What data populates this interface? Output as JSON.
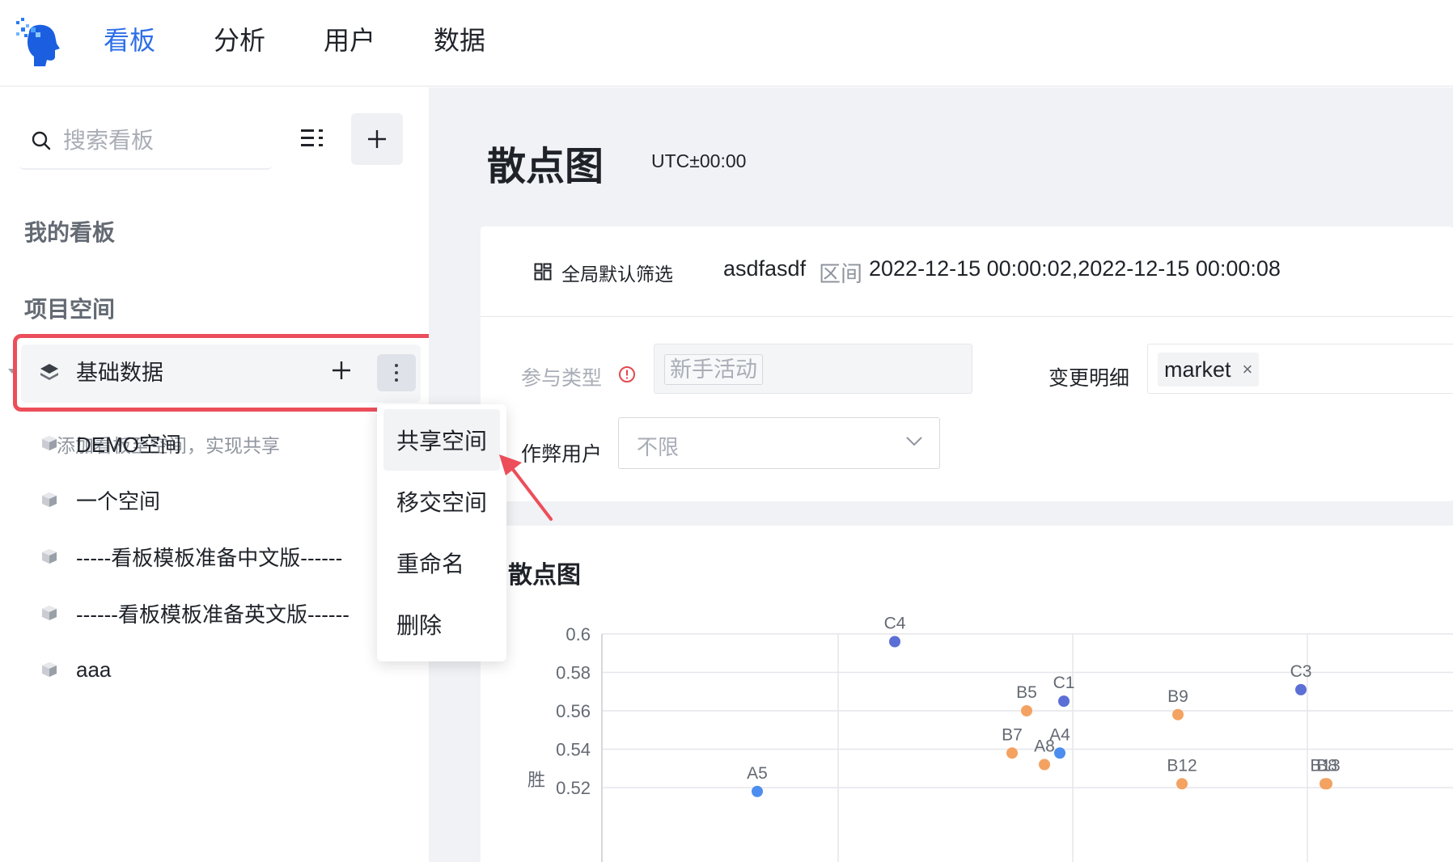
{
  "nav": {
    "items": [
      {
        "label": "看板",
        "active": true
      },
      {
        "label": "分析",
        "active": false
      },
      {
        "label": "用户",
        "active": false
      },
      {
        "label": "数据",
        "active": false
      }
    ]
  },
  "sidebar": {
    "search_placeholder": "搜索看板",
    "section_my": "我的看板",
    "section_project": "项目空间",
    "active_space": "基础数据",
    "hint": "添加看板至空间，实现共享",
    "spaces": [
      "DEMO空间",
      "一个空间",
      "-----看板模板准备中文版------",
      "------看板模板准备英文版------",
      "aaa"
    ]
  },
  "menu": {
    "items": [
      "共享空间",
      "移交空间",
      "重命名",
      "删除"
    ]
  },
  "main": {
    "title": "散点图",
    "timezone": "UTC±00:00",
    "filter": {
      "global_label": "全局默认筛选",
      "name": "asdfasdf",
      "range_label": "区间",
      "value": "2022-12-15 00:00:02,2022-12-15 00:00:08"
    },
    "fields": {
      "type_label": "参与类型",
      "type_value": "新手活动",
      "change_label": "变更明细",
      "change_tag": "market",
      "change_tag_close": "×",
      "cheat_label": "作弊用户",
      "cheat_value": "不限"
    },
    "chart_title": "散点图"
  },
  "colors": {
    "accent": "#2d6ee8",
    "highlight": "#ec4e5a",
    "series_c": "#5b6fd6",
    "series_b": "#f4a261",
    "series_a": "#4e8df0"
  },
  "chart_data": {
    "type": "scatter",
    "title": "散点图",
    "ylabel": "胜",
    "yticks": [
      "0.6",
      "0.58",
      "0.56",
      "0.54",
      "0.52"
    ],
    "ylim": [
      0.52,
      0.6
    ],
    "grid": true,
    "points": [
      {
        "label": "C4",
        "y": 0.596,
        "series": "C"
      },
      {
        "label": "C3",
        "y": 0.571,
        "series": "C"
      },
      {
        "label": "C1",
        "y": 0.565,
        "series": "C"
      },
      {
        "label": "B5",
        "y": 0.56,
        "series": "B"
      },
      {
        "label": "B9",
        "y": 0.558,
        "series": "B"
      },
      {
        "label": "B7",
        "y": 0.538,
        "series": "B"
      },
      {
        "label": "A4",
        "y": 0.538,
        "series": "A"
      },
      {
        "label": "A8",
        "y": 0.532,
        "series": "B"
      },
      {
        "label": "B12",
        "y": 0.522,
        "series": "B"
      },
      {
        "label": "B13",
        "y": 0.522,
        "series": "B"
      },
      {
        "label": "B8",
        "y": 0.522,
        "series": "B"
      },
      {
        "label": "A5",
        "y": 0.518,
        "series": "A"
      }
    ]
  }
}
